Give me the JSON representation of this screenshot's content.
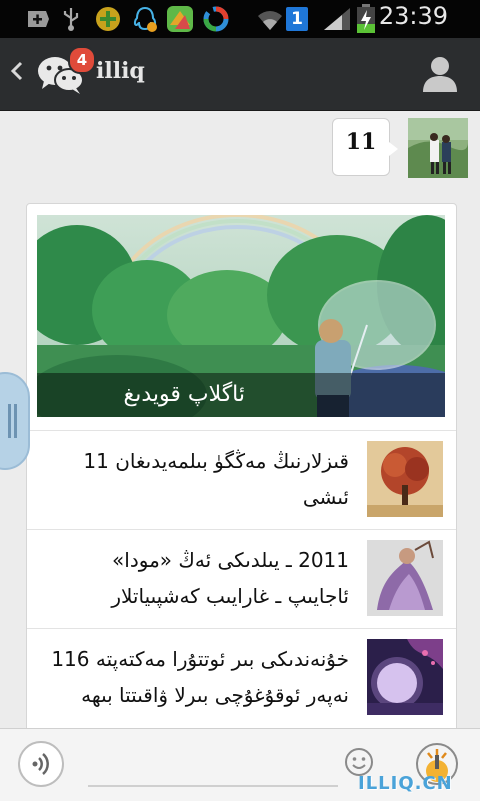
{
  "status_bar": {
    "time": "23:39",
    "sim_badge": "1",
    "icons": [
      "plus-box-icon",
      "usb-icon",
      "joystick-app-icon",
      "qq-notification-icon",
      "browser-app-icon",
      "app-ring-icon",
      "wifi-icon",
      "sim-card-icon",
      "signal-icon",
      "battery-charging-icon"
    ]
  },
  "header": {
    "title": "illiq",
    "unread_count": "4",
    "back_icon": "chevron-left-icon",
    "logo_icon": "wechat-logo-icon",
    "user_icon": "person-icon"
  },
  "chat": {
    "message_text": "11"
  },
  "article": {
    "cover_caption": "ئاگلاپ قويدىغ",
    "items": [
      {
        "title": "قىزلارنىڭ مەڭگۈ بىلمەيدىغان 11 ئىشى"
      },
      {
        "title": "2011 ـ يىلدىكى ئەڭ «مودا» ئاجايىپ ـ غارايىب كەشپىياتلار"
      },
      {
        "title": "خۇنەندىكى بىر ئوتتۇرا مەكتەپتە 116 نەپەر ئوقۇغۇچى بىرلا ۋاقىتتا بىھە"
      }
    ]
  },
  "input_bar": {
    "voice_icon": "voice-wave-icon",
    "emoji_icon": "smiley-icon",
    "more_icon": "plus-circle-icon",
    "watermark": "ILLIQ.CN"
  },
  "colors": {
    "header_bg": "#2b2d2f",
    "badge": "#e04b3a",
    "status_bg": "#050505",
    "page_bg": "#ececec"
  }
}
